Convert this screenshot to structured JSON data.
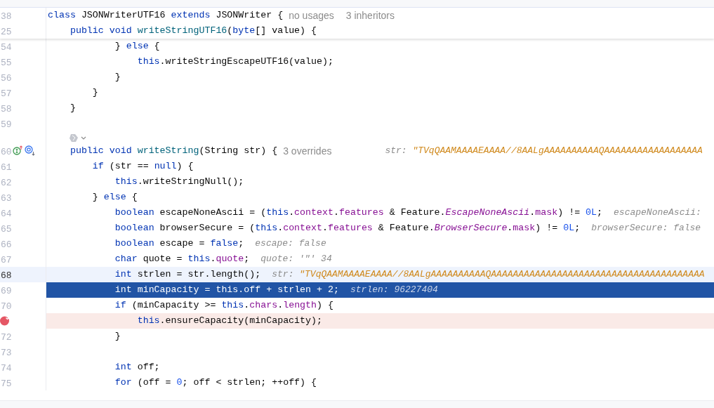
{
  "sticky_header": [
    {
      "number": "38",
      "tokens": [
        {
          "kind": "kw",
          "text": "class"
        },
        {
          "kind": "plain",
          "text": " JSONWriterUTF16 "
        },
        {
          "kind": "kw",
          "text": "extends"
        },
        {
          "kind": "plain",
          "text": " JSONWriter {"
        }
      ],
      "links": [
        "no usages",
        "3 inheritors"
      ]
    },
    {
      "number": "25",
      "tokens": [
        {
          "kind": "kw",
          "text": "    public void "
        },
        {
          "kind": "method",
          "text": "writeStringUTF16"
        },
        {
          "kind": "plain",
          "text": "("
        },
        {
          "kind": "kw",
          "text": "byte"
        },
        {
          "kind": "plain",
          "text": "[] value) {"
        }
      ]
    }
  ],
  "lines": [
    {
      "kind": "code",
      "number": "54",
      "caret_line": false,
      "execution_point": false,
      "breakpoint": false,
      "tokens": [
        {
          "kind": "plain",
          "text": "            } "
        },
        {
          "kind": "kw",
          "text": "else"
        },
        {
          "kind": "plain",
          "text": " {"
        }
      ]
    },
    {
      "kind": "code",
      "number": "55",
      "caret_line": false,
      "execution_point": false,
      "breakpoint": false,
      "tokens": [
        {
          "kind": "kw",
          "text": "                this"
        },
        {
          "kind": "plain",
          "text": ".writeStringEscapeUTF16(value);"
        }
      ]
    },
    {
      "kind": "code",
      "number": "56",
      "caret_line": false,
      "execution_point": false,
      "breakpoint": false,
      "tokens": [
        {
          "kind": "plain",
          "text": "            }"
        }
      ]
    },
    {
      "kind": "code",
      "number": "57",
      "caret_line": false,
      "execution_point": false,
      "breakpoint": false,
      "tokens": [
        {
          "kind": "plain",
          "text": "        }"
        }
      ]
    },
    {
      "kind": "code",
      "number": "58",
      "caret_line": false,
      "execution_point": false,
      "breakpoint": false,
      "tokens": [
        {
          "kind": "plain",
          "text": "    }"
        }
      ]
    },
    {
      "kind": "code",
      "number": "59",
      "caret_line": false,
      "execution_point": false,
      "breakpoint": false
    },
    {
      "kind": "ai_hint"
    },
    {
      "kind": "code",
      "number": "60",
      "caret_line": false,
      "execution_point": false,
      "breakpoint": false,
      "implements_marker": true,
      "overridden_marker": true,
      "tokens": [
        {
          "kind": "kw",
          "text": "    public void "
        },
        {
          "kind": "method",
          "text": "writeString"
        },
        {
          "kind": "plain",
          "text": "(String str) {"
        }
      ],
      "links": [
        "3 overrides"
      ],
      "hint": [
        {
          "kind": "name",
          "text": "str: "
        },
        {
          "kind": "value",
          "text": "\"TVqQAAMAAAAEAAAA//8AALgAAAAAAAAAAQAAAAAAAAAAAAAAAAAA"
        }
      ]
    },
    {
      "kind": "code",
      "number": "61",
      "caret_line": false,
      "execution_point": false,
      "breakpoint": false,
      "tokens": [
        {
          "kind": "kw",
          "text": "        if"
        },
        {
          "kind": "plain",
          "text": " (str == "
        },
        {
          "kind": "kw",
          "text": "null"
        },
        {
          "kind": "plain",
          "text": ") {"
        }
      ]
    },
    {
      "kind": "code",
      "number": "62",
      "caret_line": false,
      "execution_point": false,
      "breakpoint": false,
      "tokens": [
        {
          "kind": "kw",
          "text": "            this"
        },
        {
          "kind": "plain",
          "text": ".writeStringNull();"
        }
      ]
    },
    {
      "kind": "code",
      "number": "63",
      "caret_line": false,
      "execution_point": false,
      "breakpoint": false,
      "tokens": [
        {
          "kind": "plain",
          "text": "        } "
        },
        {
          "kind": "kw",
          "text": "else"
        },
        {
          "kind": "plain",
          "text": " {"
        }
      ]
    },
    {
      "kind": "code",
      "number": "64",
      "caret_line": false,
      "execution_point": false,
      "breakpoint": false,
      "tokens": [
        {
          "kind": "kw",
          "text": "            boolean"
        },
        {
          "kind": "plain",
          "text": " escapeNoneAscii = ("
        },
        {
          "kind": "kw",
          "text": "this"
        },
        {
          "kind": "plain",
          "text": "."
        },
        {
          "kind": "field",
          "text": "context"
        },
        {
          "kind": "plain",
          "text": "."
        },
        {
          "kind": "field",
          "text": "features"
        },
        {
          "kind": "plain",
          "text": " & Feature."
        },
        {
          "kind": "static",
          "text": "EscapeNoneAscii"
        },
        {
          "kind": "plain",
          "text": "."
        },
        {
          "kind": "field",
          "text": "mask"
        },
        {
          "kind": "plain",
          "text": ") != "
        },
        {
          "kind": "num",
          "text": "0L"
        },
        {
          "kind": "plain",
          "text": ";"
        }
      ],
      "hint": [
        {
          "kind": "name",
          "text": "escapeNoneAscii:"
        }
      ]
    },
    {
      "kind": "code",
      "number": "65",
      "caret_line": false,
      "execution_point": false,
      "breakpoint": false,
      "tokens": [
        {
          "kind": "kw",
          "text": "            boolean"
        },
        {
          "kind": "plain",
          "text": " browserSecure = ("
        },
        {
          "kind": "kw",
          "text": "this"
        },
        {
          "kind": "plain",
          "text": "."
        },
        {
          "kind": "field",
          "text": "context"
        },
        {
          "kind": "plain",
          "text": "."
        },
        {
          "kind": "field",
          "text": "features"
        },
        {
          "kind": "plain",
          "text": " & Feature."
        },
        {
          "kind": "static",
          "text": "BrowserSecure"
        },
        {
          "kind": "plain",
          "text": "."
        },
        {
          "kind": "field",
          "text": "mask"
        },
        {
          "kind": "plain",
          "text": ") != "
        },
        {
          "kind": "num",
          "text": "0L"
        },
        {
          "kind": "plain",
          "text": ";"
        }
      ],
      "hint": [
        {
          "kind": "name",
          "text": "browserSecure: false"
        }
      ]
    },
    {
      "kind": "code",
      "number": "66",
      "caret_line": false,
      "execution_point": false,
      "breakpoint": false,
      "tokens": [
        {
          "kind": "kw",
          "text": "            boolean"
        },
        {
          "kind": "plain",
          "text": " escape = "
        },
        {
          "kind": "kw",
          "text": "false"
        },
        {
          "kind": "plain",
          "text": ";"
        }
      ],
      "hint": [
        {
          "kind": "name",
          "text": "escape: false"
        }
      ]
    },
    {
      "kind": "code",
      "number": "67",
      "caret_line": false,
      "execution_point": false,
      "breakpoint": false,
      "tokens": [
        {
          "kind": "kw",
          "text": "            char"
        },
        {
          "kind": "plain",
          "text": " quote = "
        },
        {
          "kind": "kw",
          "text": "this"
        },
        {
          "kind": "plain",
          "text": "."
        },
        {
          "kind": "field",
          "text": "quote"
        },
        {
          "kind": "plain",
          "text": ";"
        }
      ],
      "hint": [
        {
          "kind": "name",
          "text": "quote: '\"' 34"
        }
      ]
    },
    {
      "kind": "code",
      "number": "68",
      "caret_line": true,
      "execution_point": false,
      "breakpoint": false,
      "tokens": [
        {
          "kind": "kw",
          "text": "            int"
        },
        {
          "kind": "plain",
          "text": " strlen = str.length();"
        }
      ],
      "hint": [
        {
          "kind": "name",
          "text": "str: "
        },
        {
          "kind": "value",
          "text": "\"TVqQAAMAAAAEAAAA//8AALgAAAAAAAAAAQAAAAAAAAAAAAAAAAAAAAAAAAAAAAAAAAAAAAAAA"
        }
      ]
    },
    {
      "kind": "code",
      "number": "69",
      "caret_line": false,
      "execution_point": true,
      "breakpoint": false,
      "tokens": [
        {
          "kind": "kw",
          "text": "            int"
        },
        {
          "kind": "plain",
          "text": " minCapacity = "
        },
        {
          "kind": "kw",
          "text": "this"
        },
        {
          "kind": "plain",
          "text": "."
        },
        {
          "kind": "field",
          "text": "off"
        },
        {
          "kind": "plain",
          "text": " + strlen + "
        },
        {
          "kind": "num",
          "text": "2"
        },
        {
          "kind": "plain",
          "text": ";"
        }
      ],
      "hint": [
        {
          "kind": "name",
          "text": "strlen: 96227404"
        }
      ]
    },
    {
      "kind": "code",
      "number": "70",
      "caret_line": false,
      "execution_point": false,
      "breakpoint": false,
      "tokens": [
        {
          "kind": "kw",
          "text": "            if"
        },
        {
          "kind": "plain",
          "text": " (minCapacity >= "
        },
        {
          "kind": "kw",
          "text": "this"
        },
        {
          "kind": "plain",
          "text": "."
        },
        {
          "kind": "field",
          "text": "chars"
        },
        {
          "kind": "plain",
          "text": "."
        },
        {
          "kind": "field",
          "text": "length"
        },
        {
          "kind": "plain",
          "text": ") {"
        }
      ]
    },
    {
      "kind": "code",
      "caret_line": false,
      "execution_point": false,
      "breakpoint": true,
      "tokens": [
        {
          "kind": "kw",
          "text": "                this"
        },
        {
          "kind": "plain",
          "text": ".ensureCapacity(minCapacity);"
        }
      ]
    },
    {
      "kind": "code",
      "number": "72",
      "caret_line": false,
      "execution_point": false,
      "breakpoint": false,
      "tokens": [
        {
          "kind": "plain",
          "text": "            }"
        }
      ]
    },
    {
      "kind": "code",
      "number": "73",
      "caret_line": false,
      "execution_point": false,
      "breakpoint": false
    },
    {
      "kind": "code",
      "number": "74",
      "caret_line": false,
      "execution_point": false,
      "breakpoint": false,
      "tokens": [
        {
          "kind": "kw",
          "text": "            int"
        },
        {
          "kind": "plain",
          "text": " off;"
        }
      ]
    },
    {
      "kind": "code",
      "number": "75",
      "caret_line": false,
      "execution_point": false,
      "breakpoint": false,
      "tokens": [
        {
          "kind": "kw",
          "text": "            for"
        },
        {
          "kind": "plain",
          "text": " (off = "
        },
        {
          "kind": "num",
          "text": "0"
        },
        {
          "kind": "plain",
          "text": "; off < strlen; ++off) {"
        }
      ]
    }
  ]
}
